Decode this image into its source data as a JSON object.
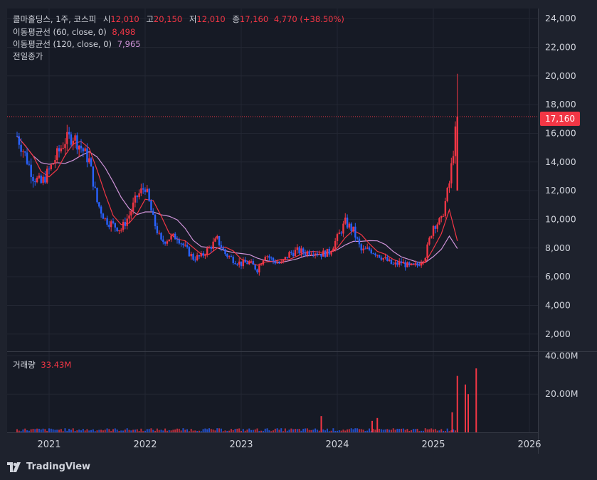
{
  "header": {
    "name": "콜마홀딩스, 1주, 코스피",
    "o_label": "시",
    "o": "12,010",
    "h_label": "고",
    "h": "20,150",
    "l_label": "저",
    "l": "12,010",
    "c_label": "종",
    "c": "17,160",
    "change": "4,770 (+38.50%)"
  },
  "ma60": {
    "label": "이동평균선 (60, close, 0)",
    "value": "8,498",
    "color": "#f23645"
  },
  "ma120": {
    "label": "이동평균선 (120, close, 0)",
    "value": "7,965",
    "color": "#ce93d8"
  },
  "prev_close_label": "전일종가",
  "volume": {
    "label": "거래량",
    "value": "33.43M"
  },
  "last_price_tag": "17,160",
  "brand": "TradingView",
  "colors": {
    "up": "#f23645",
    "down": "#2962ff",
    "bg": "#161a25",
    "ma60": "#f23645",
    "ma120": "#ce93d8"
  },
  "chart_data": {
    "type": "candlestick",
    "price_axis": {
      "ticks": [
        "2,000",
        "4,000",
        "6,000",
        "8,000",
        "10,000",
        "12,000",
        "14,000",
        "16,000",
        "18,000",
        "20,000",
        "22,000",
        "24,000"
      ],
      "range": [
        800,
        24700
      ]
    },
    "volume_axis": {
      "ticks": [
        "20.00M",
        "40.00M"
      ],
      "range": [
        0,
        42
      ]
    },
    "time_axis": {
      "ticks": [
        "2021",
        "2022",
        "2023",
        "2024",
        "2025",
        "2026"
      ]
    },
    "start_date": "2020-09",
    "close_series_monthly": [
      15800,
      14500,
      13000,
      12500,
      13400,
      14500,
      15500,
      15800,
      15000,
      14100,
      11200,
      10000,
      9600,
      9300,
      10300,
      11600,
      12300,
      10000,
      8400,
      8700,
      8800,
      8000,
      7300,
      7400,
      8000,
      8600,
      7600,
      7200,
      6900,
      7000,
      6500,
      7600,
      7100,
      6900,
      7600,
      7800,
      7700,
      7800,
      7600,
      7700,
      8700,
      9800,
      9200,
      7800,
      7900,
      7600,
      7200,
      6800,
      7000,
      6700,
      6800,
      7500,
      9600,
      9900,
      12500,
      17160
    ],
    "volume_spikes_M": [
      {
        "date": "2023-11",
        "value": 8.5
      },
      {
        "date": "2024-05",
        "value": 6.0
      },
      {
        "date": "2024-06",
        "value": 7.5
      },
      {
        "date": "2025-03",
        "value": 10.5
      },
      {
        "date": "2025-04",
        "value": 29.5
      },
      {
        "date": "2025-05",
        "value": 20.0
      },
      {
        "date": "2025-05",
        "value": 25.0
      },
      {
        "date": "2025-06",
        "value": 33.43
      }
    ],
    "ma60_last": 8498,
    "ma120_last": 7965,
    "last_close": 17160,
    "prev_close": 12390,
    "high": 20150,
    "low": 12010
  }
}
